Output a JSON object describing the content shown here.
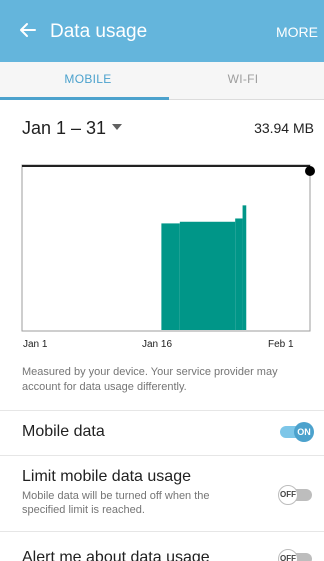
{
  "header": {
    "back_icon": "arrow-left-icon",
    "title": "Data usage",
    "more_label": "MORE",
    "color": "#64b5dc"
  },
  "tabs": [
    {
      "label": "MOBILE",
      "selected": true
    },
    {
      "label": "WI-FI",
      "selected": false
    }
  ],
  "accent_color": "#4ca2cd",
  "cycle": {
    "range": "Jan 1 – 31",
    "total": "33.94 MB"
  },
  "chart_data": {
    "type": "area",
    "x_ticks": [
      "Jan 1",
      "Jan 16",
      "Feb 1"
    ],
    "series_color": "#009688",
    "usage_bars": [
      {
        "from_day": 16,
        "to_day": 18,
        "level": 0.65
      },
      {
        "from_day": 18,
        "to_day": 24,
        "level": 0.66
      },
      {
        "from_day": 24,
        "to_day": 24.8,
        "level": 0.68
      },
      {
        "from_day": 24.8,
        "to_day": 25.2,
        "level": 0.76
      }
    ],
    "limit_line_visible": true
  },
  "note": "Measured by your device. Your service provider may account for data usage differently.",
  "settings": {
    "mobile_data": {
      "label": "Mobile data",
      "state": "ON",
      "on": true
    },
    "limit": {
      "label": "Limit mobile data usage",
      "description": "Mobile data will be turned off when the specified limit is reached.",
      "state": "OFF",
      "on": false
    },
    "alert": {
      "label": "Alert me about data usage",
      "state": "OFF",
      "on": false
    }
  }
}
